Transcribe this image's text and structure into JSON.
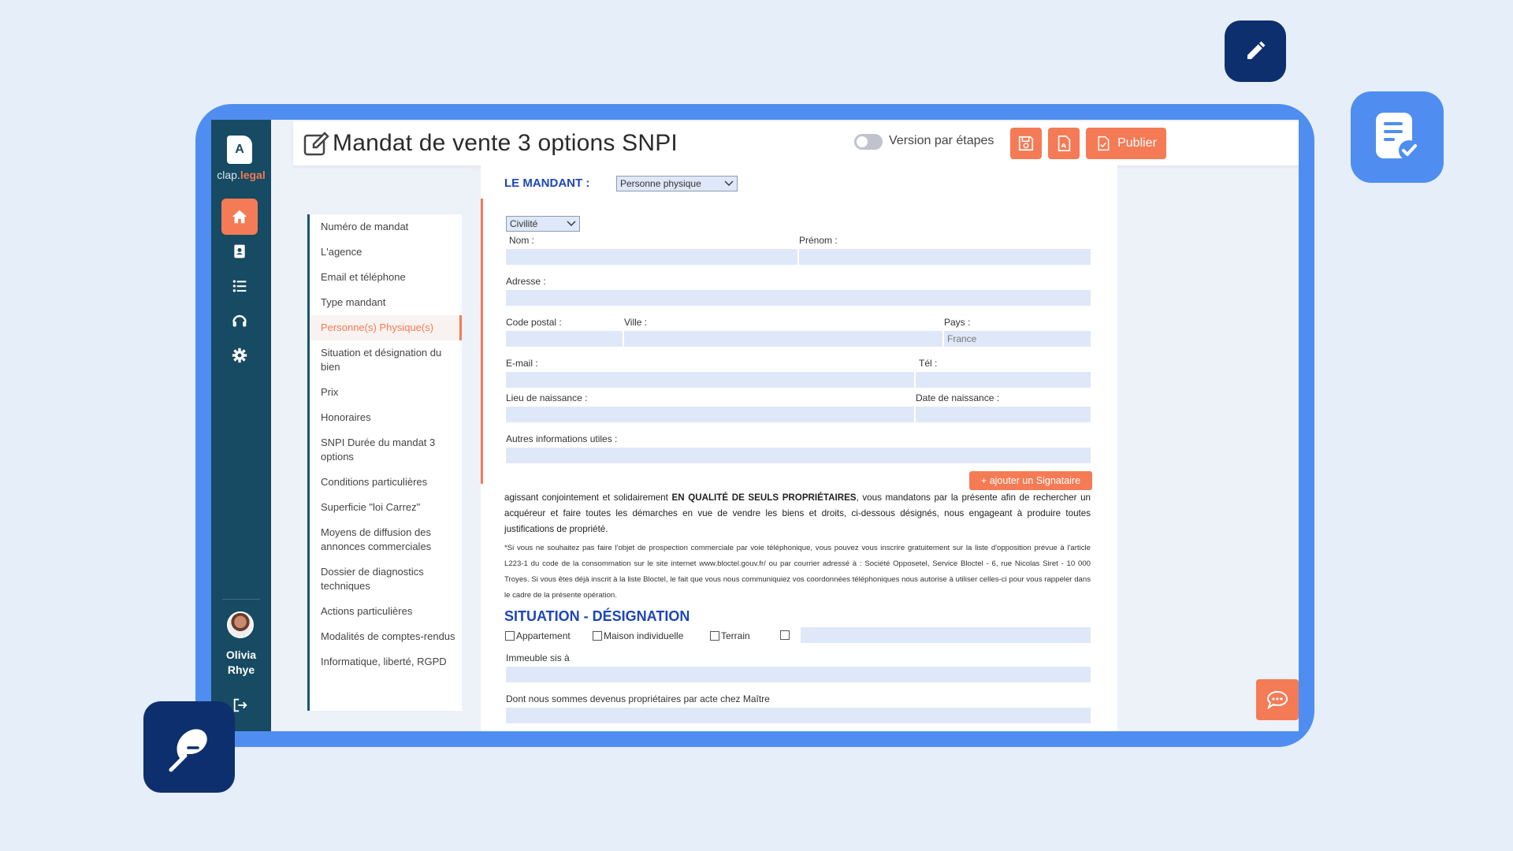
{
  "app": {
    "logo_letter": "A",
    "logo_text_a": "clap.",
    "logo_text_b": "legal",
    "user_name": "Olivia Rhye"
  },
  "header": {
    "title": "Mandat de vente 3 options SNPI",
    "toggle_label": "Version par étapes",
    "publish_label": "Publier"
  },
  "menu": {
    "items": [
      "Numéro de mandat",
      "L'agence",
      "Email et téléphone",
      "Type mandant",
      "Personne(s) Physique(s)",
      "Situation et désignation du bien",
      "Prix",
      "Honoraires",
      "SNPI Durée du mandat 3 options",
      "Conditions particulières",
      "Superficie \"loi Carrez\"",
      "Moyens de diffusion des annonces commerciales",
      "Dossier de diagnostics techniques",
      "Actions particulières",
      "Modalités de comptes-rendus",
      "Informatique, liberté, RGPD"
    ],
    "active_index": 4
  },
  "form": {
    "mandant_label": "LE MANDANT :",
    "mandant_type": "Personne physique",
    "civilite": "Civilité",
    "nom_label": "Nom :",
    "prenom_label": "Prénom :",
    "adresse_label": "Adresse :",
    "cp_label": "Code postal :",
    "ville_label": "Ville :",
    "pays_label": "Pays :",
    "pays_value": "France",
    "email_label": "E-mail :",
    "tel_label": "Tél :",
    "lieu_naissance_label": "Lieu de naissance :",
    "date_naissance_label": "Date de naissance :",
    "autres_label": "Autres informations utiles :",
    "add_signataire": "+ ajouter un Signataire",
    "para_1a": "agissant conjointement et solidairement ",
    "para_1b": "EN QUALITÉ DE SEULS PROPRIÉTAIRES",
    "para_1c": ", vous mandatons par la présente afin de rechercher un acquéreur et faire toutes les démarches en vue de vendre les biens et droits, ci-dessous désignés, nous engageant à produire toutes justifications de propriété.",
    "note": "*Si vous ne souhaitez pas faire l'objet de prospection commerciale par voie téléphonique, vous pouvez vous inscrire gratuitement sur la liste d'opposition prévue à l'article L223-1 du code de la consommation sur le site internet www.bloctel.gouv.fr/ ou par courrier adressé à : Société Opposetel, Service Bloctel - 6, rue Nicolas Siret - 10 000 Troyes. Si vous êtes déjà inscrit à la liste Bloctel, le fait que vous nous communiquiez vos coordonnées téléphoniques nous autorise à utiliser celles-ci pour vous rappeler dans le cadre de la présente opération.",
    "situation_title": "SITUATION - DÉSIGNATION",
    "cb_appartement": "Appartement",
    "cb_maison": "Maison individuelle",
    "cb_terrain": "Terrain",
    "immeuble_label": "Immeuble sis à",
    "proprietaires_label": "Dont nous sommes devenus propriétaires par acte chez Maître"
  },
  "colors": {
    "accent": "#f47b55",
    "sidebar": "#174a63",
    "frame": "#4f8ef0",
    "badge": "#0d2f6e",
    "title_blue": "#1e46b8"
  }
}
